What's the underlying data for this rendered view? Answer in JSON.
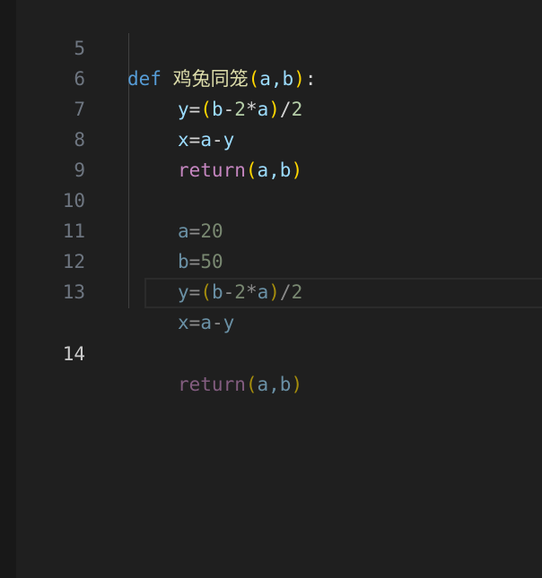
{
  "lines": [
    {
      "num": "5",
      "tokens": {
        "def": "def",
        "name": "鸡兔同笼",
        "open": "(",
        "params": "a,b",
        "close": ")",
        "colon": ":"
      }
    },
    {
      "num": "6",
      "tokens": {
        "lhs": "y",
        "eq": "=",
        "open": "(",
        "b": "b",
        "minus": "-",
        "two": "2",
        "star": "*",
        "a": "a",
        "close": ")",
        "div": "/",
        "two2": "2"
      }
    },
    {
      "num": "7",
      "tokens": {
        "lhs": "x",
        "eq": "=",
        "a": "a",
        "minus": "-",
        "y": "y"
      }
    },
    {
      "num": "8",
      "tokens": {
        "ret": "return",
        "open": "(",
        "args": "a,b",
        "close": ")"
      }
    },
    {
      "num": "9"
    },
    {
      "num": "10",
      "tokens": {
        "lhs": "a",
        "eq": "=",
        "val": "20"
      }
    },
    {
      "num": "11",
      "tokens": {
        "lhs": "b",
        "eq": "=",
        "val": "50"
      }
    },
    {
      "num": "12",
      "tokens": {
        "lhs": "y",
        "eq": "=",
        "open": "(",
        "b": "b",
        "minus": "-",
        "two": "2",
        "star": "*",
        "a": "a",
        "close": ")",
        "div": "/",
        "two2": "2"
      }
    },
    {
      "num": "13",
      "tokens": {
        "lhs": "x",
        "eq": "=",
        "a": "a",
        "minus": "-",
        "y": "y"
      }
    },
    {
      "num": "14",
      "tokens": {
        "ret": "return",
        "open": "(",
        "args": "a,b",
        "close": ")"
      }
    }
  ],
  "colors": {
    "background": "#1f1f1f",
    "keyword_def": "#569cd6",
    "function_name": "#dcdcaa",
    "variable": "#9cdcfe",
    "number": "#b5cea8",
    "keyword_return": "#c586c0",
    "bracket_level1": "#ffd700",
    "bracket_level2": "#da70d6"
  },
  "cursor_line": "14"
}
